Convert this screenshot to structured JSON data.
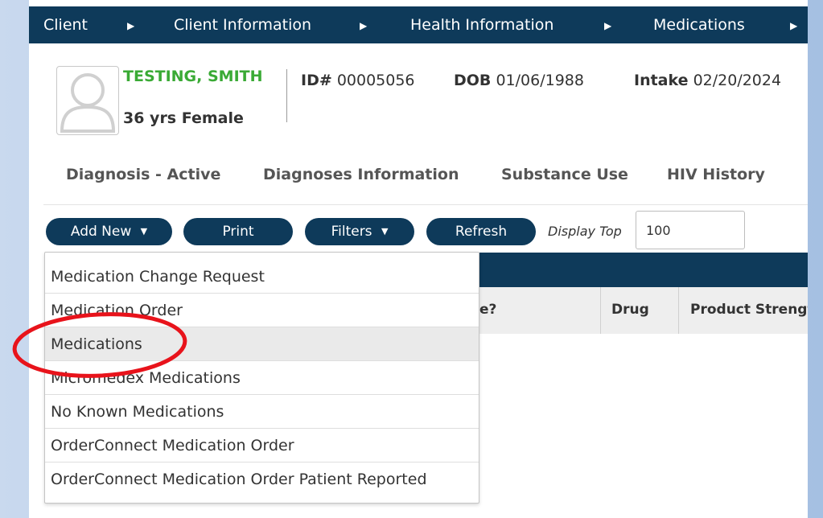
{
  "nav": {
    "crumbs": [
      "Client",
      "Client Information",
      "Health Information",
      "Medications"
    ],
    "separator": "▶"
  },
  "client": {
    "name": "TESTING, SMITH",
    "age_sex": "36 yrs Female",
    "id_label": "ID#",
    "id_value": "00005056",
    "dob_label": "DOB",
    "dob_value": "01/06/1988",
    "intake_label": "Intake",
    "intake_value": "02/20/2024"
  },
  "tabs": [
    "Diagnosis - Active",
    "Diagnoses Information",
    "Substance Use",
    "HIV History"
  ],
  "toolbar": {
    "add_new": "Add New",
    "print": "Print",
    "filters": "Filters",
    "refresh": "Refresh",
    "display_top_label": "Display Top",
    "display_top_value": "100"
  },
  "grid": {
    "columns": [
      "e?",
      "Drug",
      "Product Strength"
    ]
  },
  "dropdown": {
    "items": [
      "Medication Change Request",
      "Medication Order",
      "Medications",
      "Micromedex Medications",
      "No Known Medications",
      "OrderConnect Medication Order",
      "OrderConnect Medication Order Patient Reported"
    ],
    "highlighted_index": 2
  },
  "colors": {
    "nav_bg": "#0e3a5a",
    "name_green": "#3aaa35",
    "highlight_ring": "#e8131b"
  },
  "icons": {
    "avatar": "user-avatar-icon",
    "dropdown_caret": "caret-down-icon",
    "breadcrumb_separator": "caret-right-icon"
  }
}
